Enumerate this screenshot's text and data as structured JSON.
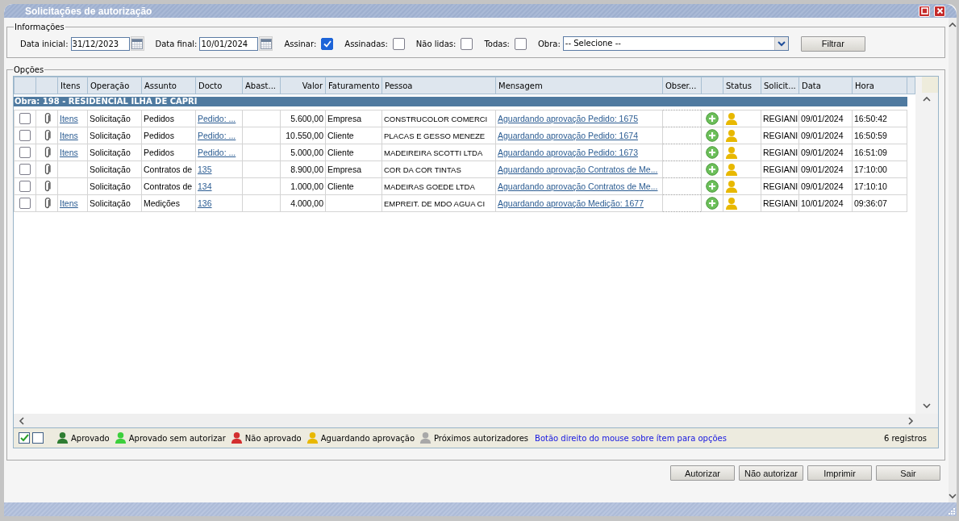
{
  "window": {
    "title": "Solicitações de autorização"
  },
  "info": {
    "legend": "Informações",
    "date_start": {
      "label": "Data inicial:",
      "value": "31/12/2023"
    },
    "date_end": {
      "label": "Data final:",
      "value": "10/01/2024"
    },
    "checks": [
      {
        "label": "Assinar:",
        "checked": true
      },
      {
        "label": "Assinadas:",
        "checked": false
      },
      {
        "label": "Não lidas:",
        "checked": false
      },
      {
        "label": "Todas:",
        "checked": false
      }
    ],
    "obra": {
      "label": "Obra:",
      "value": "-- Selecione --"
    },
    "filter_button": "Filtrar"
  },
  "options": {
    "legend": "Opções"
  },
  "table": {
    "columns": [
      "",
      "",
      "Itens",
      "Operação",
      "Assunto",
      "Docto",
      "Abast...",
      "Valor",
      "Faturamento",
      "Pessoa",
      "Mensagem",
      "Obser...",
      "",
      "Status",
      "Solicit...",
      "Data",
      "Hora"
    ],
    "group": "Obra: 198 - RESIDENCIAL ILHA DE CAPRI",
    "rows": [
      {
        "checked": false,
        "itens": "Itens",
        "operacao": "Solicitação",
        "assunto": "Pedidos",
        "docto": "Pedido: ...",
        "valor": "5.600,00",
        "faturamento": "Empresa",
        "pessoa": "CONSTRUCOLOR COMERCI",
        "mensagem": "Aguardando aprovação Pedido: 1675",
        "color": "#e8b800",
        "solicitante": "REGIANI",
        "data": "09/01/2024",
        "hora": "16:50:42"
      },
      {
        "checked": false,
        "itens": "Itens",
        "operacao": "Solicitação",
        "assunto": "Pedidos",
        "docto": "Pedido: ...",
        "valor": "10.550,00",
        "faturamento": "Cliente",
        "pessoa": "PLACAS E GESSO MENEZE",
        "mensagem": "Aguardando aprovação Pedido: 1674",
        "color": "#e8b800",
        "solicitante": "REGIANI",
        "data": "09/01/2024",
        "hora": "16:50:59"
      },
      {
        "checked": false,
        "itens": "Itens",
        "operacao": "Solicitação",
        "assunto": "Pedidos",
        "docto": "Pedido: ...",
        "valor": "5.000,00",
        "faturamento": "Cliente",
        "pessoa": "MADEIREIRA SCOTTI LTDA",
        "mensagem": "Aguardando aprovação Pedido: 1673",
        "color": "#e8b800",
        "solicitante": "REGIANI",
        "data": "09/01/2024",
        "hora": "16:51:09"
      },
      {
        "checked": false,
        "operacao": "Solicitação",
        "assunto": "Contratos de",
        "docto": "135",
        "valor": "8.900,00",
        "faturamento": "Empresa",
        "pessoa": "COR DA COR TINTAS",
        "mensagem": "Aguardando aprovação Contratos de Me...",
        "color": "#e8b800",
        "solicitante": "REGIANI",
        "data": "09/01/2024",
        "hora": "17:10:00"
      },
      {
        "checked": false,
        "operacao": "Solicitação",
        "assunto": "Contratos de",
        "docto": "134",
        "valor": "1.000,00",
        "faturamento": "Cliente",
        "pessoa": "MADEIRAS GOEDE LTDA",
        "mensagem": "Aguardando aprovação Contratos de Me...",
        "color": "#e8b800",
        "solicitante": "REGIANI",
        "data": "09/01/2024",
        "hora": "17:10:10"
      },
      {
        "checked": false,
        "itens": "Itens",
        "operacao": "Solicitação",
        "assunto": "Medições",
        "docto": "136",
        "valor": "4.000,00",
        "pessoa": "EMPREIT. DE MDO AGUA CI",
        "mensagem": "Aguardando aprovação Medição: 1677",
        "color": "#e8b800",
        "solicitante": "REGIANI",
        "data": "10/01/2024",
        "hora": "09:36:07"
      }
    ]
  },
  "footer": {
    "select_boxes": [
      {
        "checked": true
      },
      {
        "checked": false
      }
    ],
    "legend": [
      {
        "label": "Aprovado",
        "color": "#2e7d32"
      },
      {
        "label": "Aprovado sem autorizar",
        "color": "#3ccf3c"
      },
      {
        "label": "Não aprovado",
        "color": "#d32f2f"
      },
      {
        "label": "Aguardando aprovação",
        "color": "#e8b800"
      },
      {
        "label": "Próximos autorizadores",
        "color": "#a8a8a8"
      }
    ],
    "hint": "Botão direito do mouse sobre ítem para opções",
    "count": "6 registros"
  },
  "buttons": [
    "Autorizar",
    "Não autorizar",
    "Imprimir",
    "Sair"
  ]
}
